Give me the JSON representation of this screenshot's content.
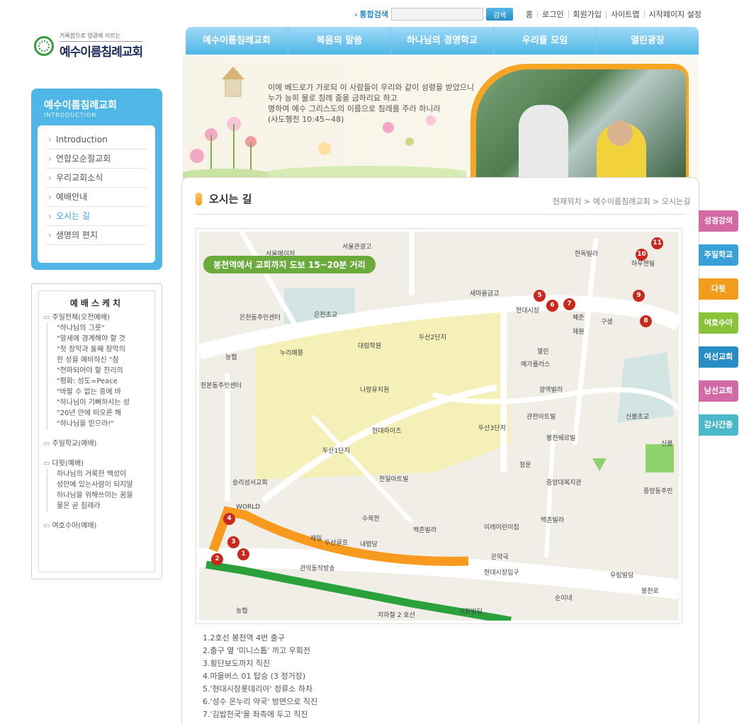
{
  "util": {
    "search_label": "통합검색",
    "search_button": "검색",
    "links": [
      "홈",
      "로그인",
      "회원가입",
      "사이트맵",
      "시작페이지 설정"
    ]
  },
  "logo": {
    "slogan": "거룩함으로 영광에 이르는",
    "name": "예수이름침례교회"
  },
  "gnb": [
    "예수이름침례교회",
    "복음의 말씀",
    "하나님의 경영학교",
    "우리들 모임",
    "열린광장"
  ],
  "side": {
    "title": "예수이름침례교회",
    "eng": "INTRODUCTION",
    "items": [
      "Introduction",
      "연합오순절교회",
      "우리교회소식",
      "예배안내",
      "오시는 길",
      "생명의 편지"
    ],
    "active": 4
  },
  "sketch": {
    "title": "예배스케치",
    "cat1": "주일전체(오전예배)",
    "cat1_items": [
      "\"하나님의 그릇\"",
      "\"말세에 경계해야 할 것",
      "\"첫 장막과 둘째 장막의",
      "한 성을 예비하신 \"참",
      "\"전파되어야 할 진리의",
      "\"평화: 성도=Peace",
      "\"바랄 수 없는 중에 바",
      "\"하나님이 기뻐하시는 성",
      "\"20년 만에 떠오른 해",
      "\"하나님을 믿으라!\""
    ],
    "cat2": "주일학교(예배)",
    "cat3": "다윗(예배)",
    "cat3_items": [
      "하나님의 거룩한 백성이",
      "성안에 있는사람이 되지말",
      "하나님을 위해쓰이는 꿈을",
      "물은 곧 침례라"
    ],
    "cat4": "여호수아(예배)"
  },
  "banner": {
    "verse": [
      "이에 베드로가 가로되 이 사람들이 우리와 같이 성령을 받았으니",
      "누가 능히 물로 침례 줌을 금하리요 하고",
      "명하여 예수 그리스도의 이름으로 침례를 주라 하니라",
      "(사도행전 10:45~48)"
    ]
  },
  "page": {
    "title": "오시는 길",
    "breadcrumb": "현재위치 > 예수이름침례교회 > 오시는길"
  },
  "map": {
    "callout": "봉천역에서 교회까지 도보 15~20분 거리",
    "labels": [
      "서울메이저",
      "서울관광고",
      "은천동주민센터",
      "은천초교",
      "농협",
      "누리예뜰",
      "대림학원",
      "두산2단지",
      "새마을금고",
      "현대시장",
      "혜준",
      "구생",
      "제원",
      "열린",
      "메가플러스",
      "천본동주민센터",
      "나랑유치원",
      "광역빌라",
      "관천아트빌",
      "봉천쉐르빌",
      "신봉초교",
      "현대하이츠",
      "두산3단지",
      "두산1단지",
      "청운",
      "천일아트빌",
      "중앙대복지관",
      "중앙동주민",
      "승리성서교회",
      "수목한",
      "백촌빌라",
      "이레어린이집",
      "제일",
      "두산골프",
      "내령당",
      "은약국",
      "현대시장입구",
      "관악동작방송",
      "우림빌딩",
      "농협",
      "서원빌딩",
      "순이네",
      "봉천로",
      "지하철 2 호선",
      "한독빌라",
      "하우젠빌",
      "신봉",
      "백촌빌라",
      "WORLD"
    ],
    "markers": [
      "1",
      "2",
      "3",
      "4",
      "5",
      "6",
      "7",
      "8",
      "9",
      "10",
      "11"
    ]
  },
  "directions": [
    "1.2호선 봉천역 4번 출구",
    "2.출구 옆 '미니스톱' 끼고 우회전",
    "3.횡단보도까지 직진",
    "4.마을버스 01 탑승 (3 정거장)",
    "5.'현대시장롯데리아' 정류소 하차",
    "6.'성수 온누리 약국' 방면으로 직진",
    "7.'김밥천국'을 좌측에 두고 직진"
  ],
  "quick": [
    {
      "label": "성경강의",
      "color": "#d36aa6"
    },
    {
      "label": "주일학교",
      "color": "#3aa1d8"
    },
    {
      "label": "다윗",
      "color": "#f39b1c"
    },
    {
      "label": "여호수아",
      "color": "#8ac43b"
    },
    {
      "label": "여선교회",
      "color": "#2a8cc4"
    },
    {
      "label": "남선교회",
      "color": "#d36aa6"
    },
    {
      "label": "감사간증",
      "color": "#49b8c9"
    }
  ]
}
